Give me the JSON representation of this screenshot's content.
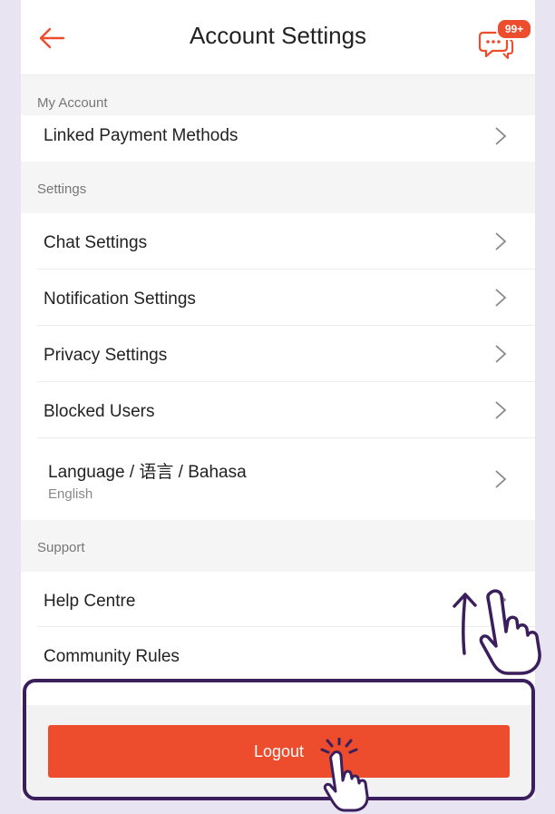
{
  "header": {
    "title": "Account Settings",
    "chat_badge": "99+"
  },
  "sections": {
    "my_account": "My Account",
    "settings": "Settings",
    "support": "Support"
  },
  "rows": {
    "linked_payment": "Linked Payment Methods",
    "chat_settings": "Chat Settings",
    "notification_settings": "Notification Settings",
    "privacy_settings": "Privacy Settings",
    "blocked_users": "Blocked Users",
    "language": "Language / 语言 / Bahasa",
    "language_value": "English",
    "help_centre": "Help Centre",
    "community_rules": "Community Rules"
  },
  "logout": {
    "label": "Logout"
  },
  "colors": {
    "accent": "#ee4d2d",
    "annotation": "#3b1f5c",
    "background": "#e9e4f1"
  },
  "icons": [
    "back-arrow-icon",
    "chat-icon",
    "chevron-right-icon",
    "hand-pointer-icon",
    "scroll-up-arrow-icon",
    "tap-sparkle-icon"
  ]
}
